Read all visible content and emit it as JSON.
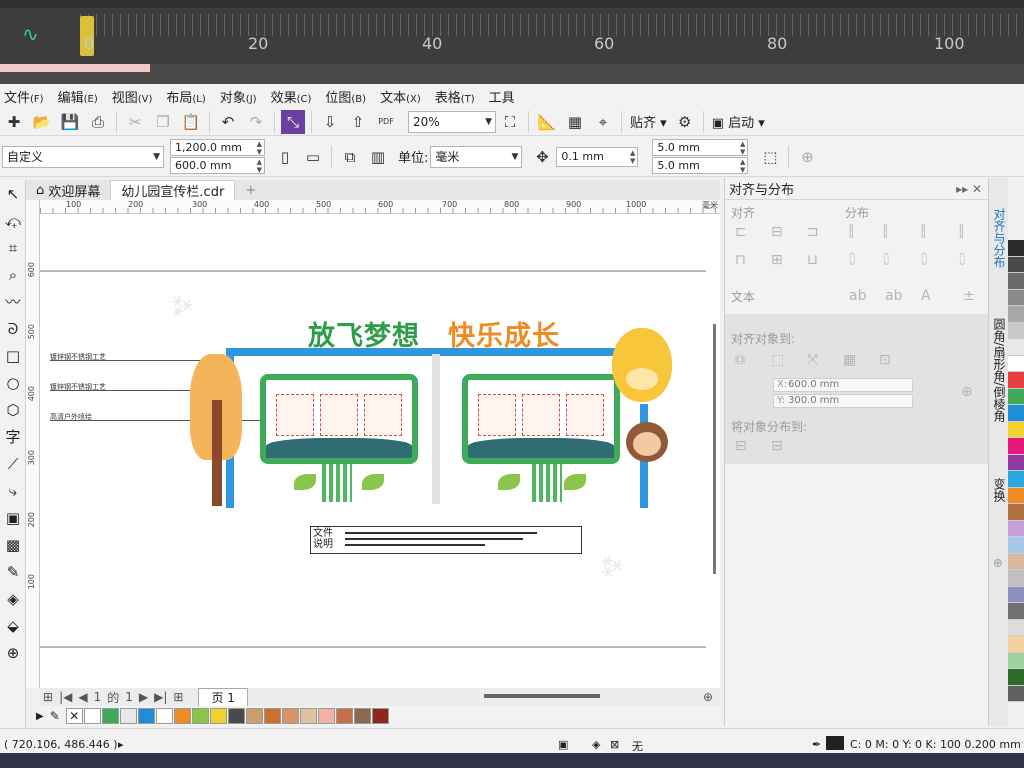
{
  "timeline": {
    "ticks": [
      "0",
      "20",
      "40",
      "60",
      "80",
      "100"
    ]
  },
  "menu": {
    "items": [
      {
        "label": "文件",
        "key": "(F)"
      },
      {
        "label": "编辑",
        "key": "(E)"
      },
      {
        "label": "视图",
        "key": "(V)"
      },
      {
        "label": "布局",
        "key": "(L)"
      },
      {
        "label": "对象",
        "key": "(J)"
      },
      {
        "label": "效果",
        "key": "(C)"
      },
      {
        "label": "位图",
        "key": "(B)"
      },
      {
        "label": "文本",
        "key": "(X)"
      },
      {
        "label": "表格",
        "key": "(T)"
      },
      {
        "label": "工具",
        "key": ""
      }
    ]
  },
  "toolbar1": {
    "zoom": "20%",
    "snap_label": "贴齐",
    "launch_label": "启动",
    "pdf_label": "PDF"
  },
  "toolbar2": {
    "preset": "自定义",
    "width": "1,200.0 mm",
    "height": "600.0 mm",
    "units_label": "单位:",
    "units": "毫米",
    "nudge": "0.1 mm",
    "dup_x": "5.0 mm",
    "dup_y": "5.0 mm"
  },
  "tabs": {
    "welcome": "欢迎屏幕",
    "document": "幼儿园宣传栏.cdr"
  },
  "ruler": {
    "h_labels": [
      "100",
      "200",
      "300",
      "400",
      "500",
      "600",
      "700",
      "800",
      "900",
      "1000"
    ],
    "h_unit": "毫米",
    "v_labels": [
      "600",
      "500",
      "400",
      "300",
      "200",
      "100"
    ]
  },
  "artwork": {
    "headline_left": "放飞梦想",
    "headline_right": "快乐成长",
    "annotations": [
      "镀锌钢不锈钢工艺",
      "镀锌钢不锈钢工艺",
      "高清户外喷绘"
    ],
    "note_label": "文件说明"
  },
  "pagenav": {
    "current": "1",
    "of": "的",
    "total": "1",
    "page_tab": "页 1"
  },
  "palette": {
    "bottom": [
      "#ffffff",
      "#3faa5a",
      "#e8e8e8",
      "#1e8fd6",
      "#ffffff",
      "#ee8c22",
      "#8bc44a",
      "#f1d22c",
      "#4a4a4a",
      "#c8a070",
      "#c9722e",
      "#d9946a",
      "#e2c29e",
      "#f2b2a8",
      "#c56f4e",
      "#8a6a4a",
      "#8b2a1c"
    ],
    "right": [
      "#2a2a2a",
      "#4a4a4a",
      "#6a6a6a",
      "#8a8a8a",
      "#a8a8a8",
      "#c8c8c8",
      "#e8e8e8",
      "#ffffff",
      "#e84040",
      "#3faa5a",
      "#1e8fd6",
      "#f1d22c",
      "#e2197a",
      "#8e3a9e",
      "#29a8e0",
      "#ee8c22",
      "#b07040",
      "#c8a0d8",
      "#a6c8e8",
      "#d9b8a0",
      "#c0c0c0",
      "#9090c0",
      "#707070",
      "#dcdcdc",
      "#f4d0a0",
      "#a0d0a0",
      "#2a6a2a",
      "#606060"
    ]
  },
  "docker": {
    "title": "对齐与分布",
    "align_section": "对齐",
    "distribute_section": "分布",
    "text_section": "文本",
    "align_to_label": "对齐对象到:",
    "x_value": "600.0 mm",
    "y_value": "300.0 mm",
    "distribute_to_label": "将对象分布到:",
    "vtabs": [
      "对齐与分布",
      "圆角/扇形角/倒棱角",
      "变换"
    ]
  },
  "status": {
    "coords": "( 720.106, 486.446 )",
    "fill_none": "无",
    "outline": "C: 0 M: 0 Y: 0 K: 100  0.200 mm"
  }
}
